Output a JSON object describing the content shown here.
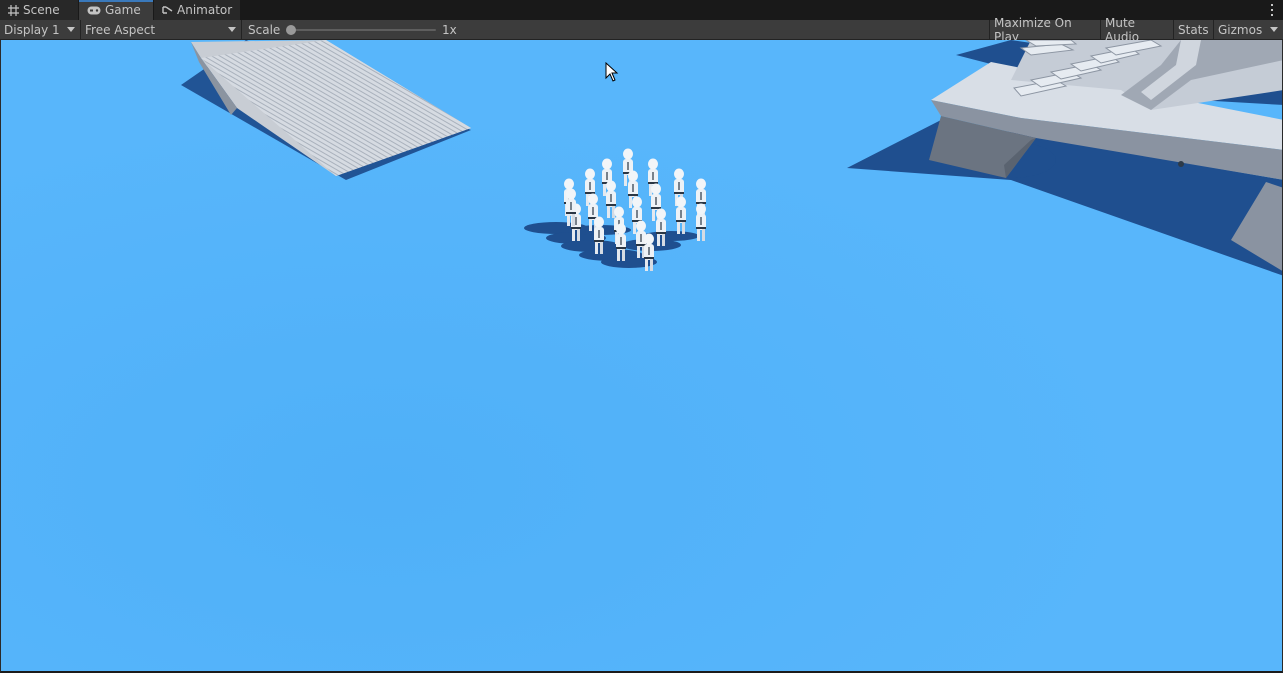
{
  "tabs": {
    "scene": "Scene",
    "game": "Game",
    "animator": "Animator"
  },
  "toolbar": {
    "display": "Display 1",
    "aspect": "Free Aspect",
    "scale_label": "Scale",
    "scale_value": "1x",
    "maximize": "Maximize On Play",
    "mute": "Mute Audio",
    "stats": "Stats",
    "gizmos": "Gizmos"
  },
  "colors": {
    "ground": "#58b6fb",
    "shadow": "#1f4f8f",
    "active_tab_accent": "#3a79bb",
    "toolbar_bg": "#3c3c3c"
  },
  "icons": {
    "scene": "grid-icon",
    "game": "gamepad-icon",
    "animator": "animator-icon",
    "menu": "kebab-menu-icon",
    "cursor": "mouse-pointer-icon"
  }
}
